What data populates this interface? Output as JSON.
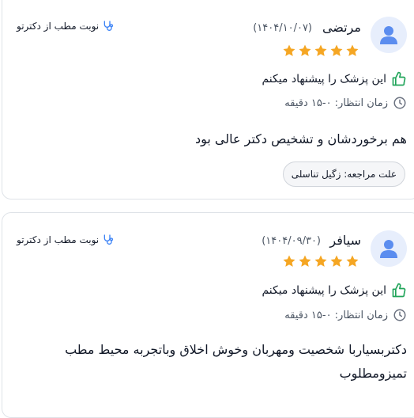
{
  "reviews": [
    {
      "name": "مرتضی",
      "date": "(۱۴۰۴/۱۰/۰۷)",
      "rating": 5,
      "booking": "نوبت مطب از دکترتو",
      "recommend": "این پزشک را پیشنهاد میکنم",
      "wait": "زمان انتظار: ۰-۱۵ دقیقه",
      "comment": "هم برخوردشان و تشخیص دکتر عالی بود",
      "reason": "علت مراجعه: زگیل تناسلی"
    },
    {
      "name": "سیافر",
      "date": "(۱۴۰۴/۰۹/۳۰)",
      "rating": 5,
      "booking": "نوبت مطب از دکترتو",
      "recommend": "این پزشک را پیشنهاد میکنم",
      "wait": "زمان انتظار: ۰-۱۵ دقیقه",
      "comment": "دکتربسیاربا شخصیت ومهربان وخوش اخلاق وباتجربه محیط مطب تمیزومطلوب"
    }
  ],
  "colors": {
    "star": "#f5a623",
    "thumb": "#22a55b",
    "stethoscope": "#3b82f6",
    "avatar_bg": "#e7eefc",
    "avatar_fg": "#5b8def"
  }
}
